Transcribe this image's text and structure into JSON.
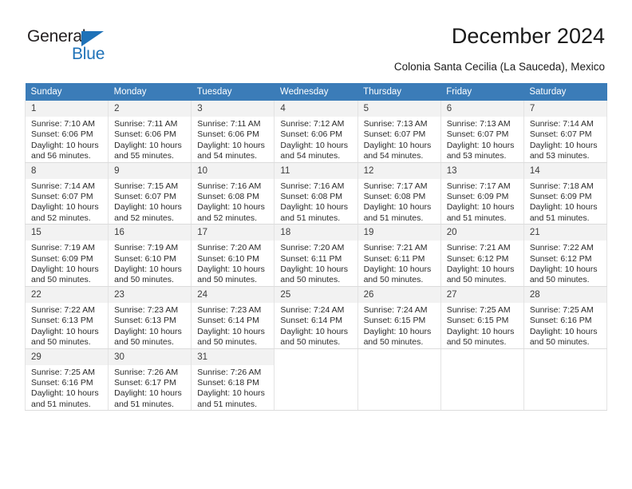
{
  "brand": {
    "name_part1": "General",
    "name_part2": "Blue",
    "accent_color": "#1f72b8",
    "triangle_icon": "logo-triangle-icon"
  },
  "header": {
    "title": "December 2024",
    "subtitle": "Colonia Santa Cecilia (La Sauceda), Mexico"
  },
  "theme": {
    "header_row_bg": "#3b7cb8",
    "header_row_text": "#ffffff",
    "daynum_bg": "#f2f2f2",
    "cell_border": "#e3e3e3",
    "body_text": "#2b2b2b"
  },
  "calendar": {
    "columns": [
      "Sunday",
      "Monday",
      "Tuesday",
      "Wednesday",
      "Thursday",
      "Friday",
      "Saturday"
    ],
    "weeks": [
      [
        {
          "day": "1",
          "sunrise": "Sunrise: 7:10 AM",
          "sunset": "Sunset: 6:06 PM",
          "daylight1": "Daylight: 10 hours",
          "daylight2": "and 56 minutes."
        },
        {
          "day": "2",
          "sunrise": "Sunrise: 7:11 AM",
          "sunset": "Sunset: 6:06 PM",
          "daylight1": "Daylight: 10 hours",
          "daylight2": "and 55 minutes."
        },
        {
          "day": "3",
          "sunrise": "Sunrise: 7:11 AM",
          "sunset": "Sunset: 6:06 PM",
          "daylight1": "Daylight: 10 hours",
          "daylight2": "and 54 minutes."
        },
        {
          "day": "4",
          "sunrise": "Sunrise: 7:12 AM",
          "sunset": "Sunset: 6:06 PM",
          "daylight1": "Daylight: 10 hours",
          "daylight2": "and 54 minutes."
        },
        {
          "day": "5",
          "sunrise": "Sunrise: 7:13 AM",
          "sunset": "Sunset: 6:07 PM",
          "daylight1": "Daylight: 10 hours",
          "daylight2": "and 54 minutes."
        },
        {
          "day": "6",
          "sunrise": "Sunrise: 7:13 AM",
          "sunset": "Sunset: 6:07 PM",
          "daylight1": "Daylight: 10 hours",
          "daylight2": "and 53 minutes."
        },
        {
          "day": "7",
          "sunrise": "Sunrise: 7:14 AM",
          "sunset": "Sunset: 6:07 PM",
          "daylight1": "Daylight: 10 hours",
          "daylight2": "and 53 minutes."
        }
      ],
      [
        {
          "day": "8",
          "sunrise": "Sunrise: 7:14 AM",
          "sunset": "Sunset: 6:07 PM",
          "daylight1": "Daylight: 10 hours",
          "daylight2": "and 52 minutes."
        },
        {
          "day": "9",
          "sunrise": "Sunrise: 7:15 AM",
          "sunset": "Sunset: 6:07 PM",
          "daylight1": "Daylight: 10 hours",
          "daylight2": "and 52 minutes."
        },
        {
          "day": "10",
          "sunrise": "Sunrise: 7:16 AM",
          "sunset": "Sunset: 6:08 PM",
          "daylight1": "Daylight: 10 hours",
          "daylight2": "and 52 minutes."
        },
        {
          "day": "11",
          "sunrise": "Sunrise: 7:16 AM",
          "sunset": "Sunset: 6:08 PM",
          "daylight1": "Daylight: 10 hours",
          "daylight2": "and 51 minutes."
        },
        {
          "day": "12",
          "sunrise": "Sunrise: 7:17 AM",
          "sunset": "Sunset: 6:08 PM",
          "daylight1": "Daylight: 10 hours",
          "daylight2": "and 51 minutes."
        },
        {
          "day": "13",
          "sunrise": "Sunrise: 7:17 AM",
          "sunset": "Sunset: 6:09 PM",
          "daylight1": "Daylight: 10 hours",
          "daylight2": "and 51 minutes."
        },
        {
          "day": "14",
          "sunrise": "Sunrise: 7:18 AM",
          "sunset": "Sunset: 6:09 PM",
          "daylight1": "Daylight: 10 hours",
          "daylight2": "and 51 minutes."
        }
      ],
      [
        {
          "day": "15",
          "sunrise": "Sunrise: 7:19 AM",
          "sunset": "Sunset: 6:09 PM",
          "daylight1": "Daylight: 10 hours",
          "daylight2": "and 50 minutes."
        },
        {
          "day": "16",
          "sunrise": "Sunrise: 7:19 AM",
          "sunset": "Sunset: 6:10 PM",
          "daylight1": "Daylight: 10 hours",
          "daylight2": "and 50 minutes."
        },
        {
          "day": "17",
          "sunrise": "Sunrise: 7:20 AM",
          "sunset": "Sunset: 6:10 PM",
          "daylight1": "Daylight: 10 hours",
          "daylight2": "and 50 minutes."
        },
        {
          "day": "18",
          "sunrise": "Sunrise: 7:20 AM",
          "sunset": "Sunset: 6:11 PM",
          "daylight1": "Daylight: 10 hours",
          "daylight2": "and 50 minutes."
        },
        {
          "day": "19",
          "sunrise": "Sunrise: 7:21 AM",
          "sunset": "Sunset: 6:11 PM",
          "daylight1": "Daylight: 10 hours",
          "daylight2": "and 50 minutes."
        },
        {
          "day": "20",
          "sunrise": "Sunrise: 7:21 AM",
          "sunset": "Sunset: 6:12 PM",
          "daylight1": "Daylight: 10 hours",
          "daylight2": "and 50 minutes."
        },
        {
          "day": "21",
          "sunrise": "Sunrise: 7:22 AM",
          "sunset": "Sunset: 6:12 PM",
          "daylight1": "Daylight: 10 hours",
          "daylight2": "and 50 minutes."
        }
      ],
      [
        {
          "day": "22",
          "sunrise": "Sunrise: 7:22 AM",
          "sunset": "Sunset: 6:13 PM",
          "daylight1": "Daylight: 10 hours",
          "daylight2": "and 50 minutes."
        },
        {
          "day": "23",
          "sunrise": "Sunrise: 7:23 AM",
          "sunset": "Sunset: 6:13 PM",
          "daylight1": "Daylight: 10 hours",
          "daylight2": "and 50 minutes."
        },
        {
          "day": "24",
          "sunrise": "Sunrise: 7:23 AM",
          "sunset": "Sunset: 6:14 PM",
          "daylight1": "Daylight: 10 hours",
          "daylight2": "and 50 minutes."
        },
        {
          "day": "25",
          "sunrise": "Sunrise: 7:24 AM",
          "sunset": "Sunset: 6:14 PM",
          "daylight1": "Daylight: 10 hours",
          "daylight2": "and 50 minutes."
        },
        {
          "day": "26",
          "sunrise": "Sunrise: 7:24 AM",
          "sunset": "Sunset: 6:15 PM",
          "daylight1": "Daylight: 10 hours",
          "daylight2": "and 50 minutes."
        },
        {
          "day": "27",
          "sunrise": "Sunrise: 7:25 AM",
          "sunset": "Sunset: 6:15 PM",
          "daylight1": "Daylight: 10 hours",
          "daylight2": "and 50 minutes."
        },
        {
          "day": "28",
          "sunrise": "Sunrise: 7:25 AM",
          "sunset": "Sunset: 6:16 PM",
          "daylight1": "Daylight: 10 hours",
          "daylight2": "and 50 minutes."
        }
      ],
      [
        {
          "day": "29",
          "sunrise": "Sunrise: 7:25 AM",
          "sunset": "Sunset: 6:16 PM",
          "daylight1": "Daylight: 10 hours",
          "daylight2": "and 51 minutes."
        },
        {
          "day": "30",
          "sunrise": "Sunrise: 7:26 AM",
          "sunset": "Sunset: 6:17 PM",
          "daylight1": "Daylight: 10 hours",
          "daylight2": "and 51 minutes."
        },
        {
          "day": "31",
          "sunrise": "Sunrise: 7:26 AM",
          "sunset": "Sunset: 6:18 PM",
          "daylight1": "Daylight: 10 hours",
          "daylight2": "and 51 minutes."
        },
        {
          "day": "",
          "sunrise": "",
          "sunset": "",
          "daylight1": "",
          "daylight2": ""
        },
        {
          "day": "",
          "sunrise": "",
          "sunset": "",
          "daylight1": "",
          "daylight2": ""
        },
        {
          "day": "",
          "sunrise": "",
          "sunset": "",
          "daylight1": "",
          "daylight2": ""
        },
        {
          "day": "",
          "sunrise": "",
          "sunset": "",
          "daylight1": "",
          "daylight2": ""
        }
      ]
    ]
  }
}
